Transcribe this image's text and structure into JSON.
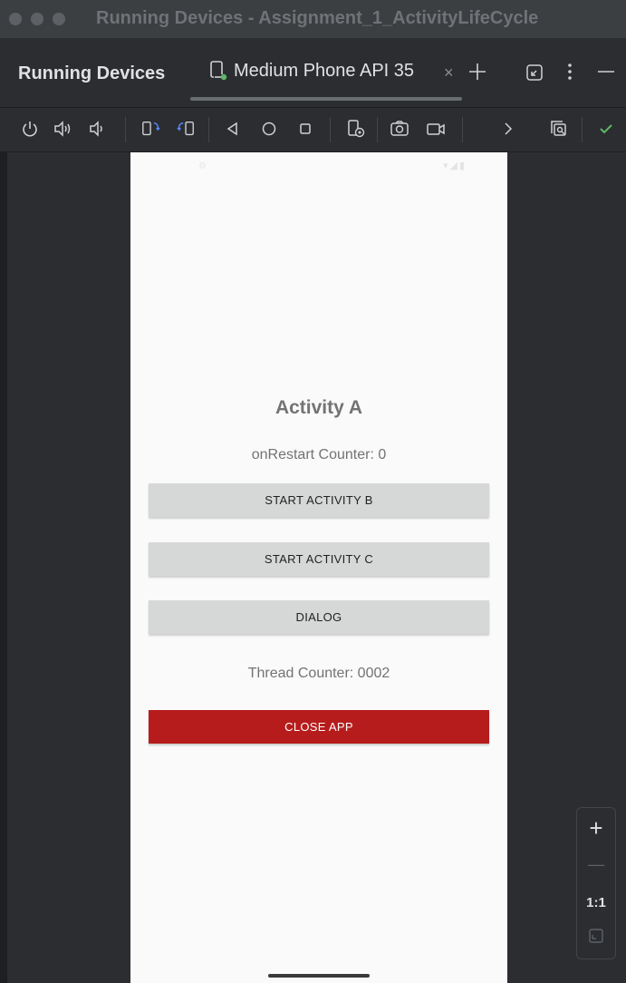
{
  "window": {
    "title": "Running Devices - Assignment_1_ActivityLifeCycle"
  },
  "tool_window": {
    "label": "Running Devices"
  },
  "tab": {
    "label": "Medium Phone API 35",
    "close_glyph": "×"
  },
  "header_icons": [
    "add-icon",
    "collapse-icon",
    "more-options-icon",
    "minimize-icon"
  ],
  "toolbar_icons": [
    "power-icon",
    "volume-up-icon",
    "volume-down-icon",
    "rotate-left-icon",
    "rotate-right-icon",
    "back-icon",
    "home-icon",
    "overview-icon",
    "device-settings-icon",
    "screenshot-icon",
    "screen-record-icon",
    "more-icon",
    "layout-inspector-icon",
    "check-icon"
  ],
  "app": {
    "title": "Activity A",
    "restart_counter": "onRestart Counter: 0",
    "buttons": [
      "START ACTIVITY B",
      "START ACTIVITY C",
      "DIALOG"
    ],
    "thread_counter": "Thread Counter: 0002",
    "close_button": "CLOSE APP"
  },
  "zoom": {
    "in": "+",
    "out": "—",
    "actual": "1:1"
  },
  "colors": {
    "close_button": "#b71c1c",
    "check": "#5fb865",
    "rotate_icon": "#548af7",
    "device_dot": "#5fb865"
  }
}
